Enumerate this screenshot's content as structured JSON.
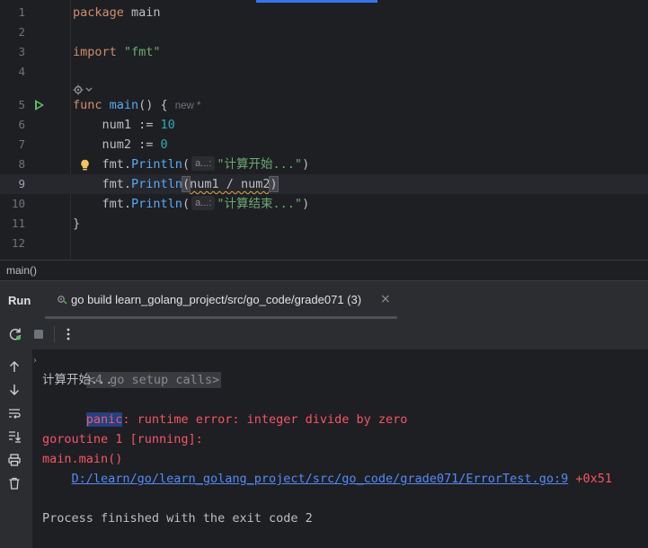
{
  "editor": {
    "lines": [
      {
        "n": "1"
      },
      {
        "n": "2"
      },
      {
        "n": "3"
      },
      {
        "n": "4"
      },
      {
        "n": "5"
      },
      {
        "n": "6"
      },
      {
        "n": "7"
      },
      {
        "n": "8"
      },
      {
        "n": "9"
      },
      {
        "n": "10"
      },
      {
        "n": "11"
      },
      {
        "n": "12"
      }
    ],
    "kw_package": "package",
    "pkg_name": "main",
    "kw_import": "import",
    "import_path": "\"fmt\"",
    "kw_func": "func",
    "func_name": "main",
    "func_sig": "() {",
    "new_hint": "new *",
    "num1": "num1 := ",
    "num1_val": "10",
    "num2": "num2 := ",
    "num2_val": "0",
    "fmt": "fmt.",
    "println": "Println",
    "open_paren": "(",
    "close_paren": ")",
    "param_hint": "a...:",
    "str_start": "\"计算开始...\"",
    "divide_args": "num1 / num2",
    "str_end": "\"计算结束...\"",
    "closing_brace": "}"
  },
  "breadcrumb": "main()",
  "run": {
    "title": "Run",
    "tab_label": "go build learn_golang_project/src/go_code/grade071 (3)",
    "close_glyph": "×"
  },
  "console": {
    "setup_calls": "<4 go setup calls>",
    "line_start": "计算开始...",
    "panic_word": "panic",
    "panic_rest": ": runtime error: integer divide by zero",
    "goroutine": "goroutine 1 [running]:",
    "main_main": "main.main()",
    "trace_link": "D:/learn/go/learn_golang_project/src/go_code/grade071/ErrorTest.go:9",
    "trace_offset": " +0x51",
    "process_finished": "Process finished with the exit code 2"
  },
  "colors": {
    "accent": "#3574f0",
    "run_green": "#5fb865",
    "error_red": "#f75464",
    "link_blue": "#548af7"
  }
}
